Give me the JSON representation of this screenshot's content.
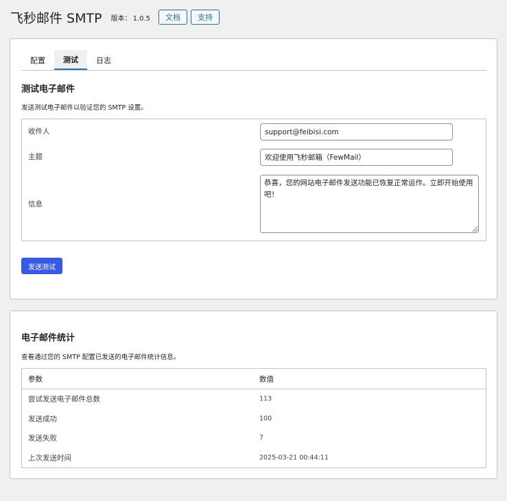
{
  "header": {
    "title": "飞秒邮件 SMTP",
    "version_label": "版本：",
    "version": "1.0.5",
    "docs_button": "文档",
    "support_button": "支持"
  },
  "tabs": [
    {
      "label": "配置",
      "active": false
    },
    {
      "label": "测试",
      "active": true
    },
    {
      "label": "日志",
      "active": false
    }
  ],
  "test_email": {
    "title": "测试电子邮件",
    "description": "发送测试电子邮件以验证您的 SMTP 设置。",
    "recipient_label": "收件人",
    "recipient_value": "support@feibisi.com",
    "subject_label": "主题",
    "subject_value": "欢迎使用飞秒邮箱（FewMail）",
    "message_label": "信息",
    "message_value": "恭喜，您的网站电子邮件发送功能已恢复正常运作。立即开始使用吧！",
    "send_button": "发送测试"
  },
  "stats": {
    "title": "电子邮件统计",
    "description": "查看通过您的 SMTP 配置已发送的电子邮件统计信息。",
    "col_param": "参数",
    "col_value": "数值",
    "rows": [
      {
        "param": "尝试发送电子邮件总数",
        "value": "113"
      },
      {
        "param": "发送成功",
        "value": "100"
      },
      {
        "param": "发送失败",
        "value": "7"
      },
      {
        "param": "上次发送时间",
        "value": "2025-03-21 00:44:11"
      }
    ]
  },
  "colors": {
    "accent": "#2271b1",
    "primary_button": "#3858e9",
    "background": "#f0f0f1"
  }
}
